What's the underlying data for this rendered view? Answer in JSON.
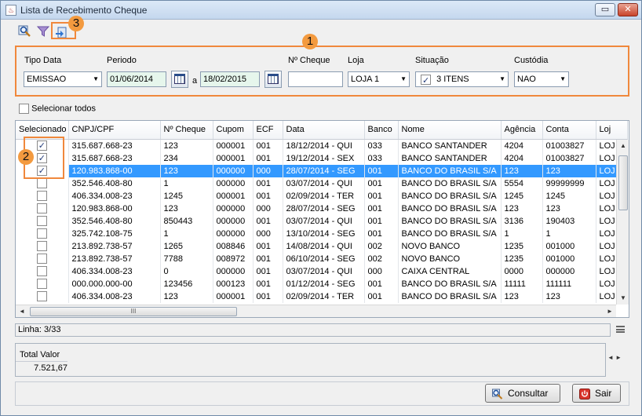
{
  "window": {
    "title": "Lista de Recebimento Cheque",
    "restore_glyph": "▭",
    "close_glyph": "✕"
  },
  "toolbar": {
    "icons": [
      "search-icon",
      "filter-icon",
      "export-icon"
    ]
  },
  "badges": [
    "1",
    "2",
    "3"
  ],
  "filters": {
    "tipo_data": {
      "label": "Tipo Data",
      "value": "EMISSAO"
    },
    "periodo": {
      "label": "Periodo",
      "from": "01/06/2014",
      "sep": "a",
      "to": "18/02/2015"
    },
    "cheque": {
      "label": "Nº Cheque",
      "value": ""
    },
    "loja": {
      "label": "Loja",
      "value": "LOJA 1"
    },
    "situacao": {
      "label": "Situação",
      "value": "3 ITENS"
    },
    "custodia": {
      "label": "Custódia",
      "value": "NAO"
    }
  },
  "select_all": {
    "label": "Selecionar todos"
  },
  "table": {
    "columns": [
      "Selecionado",
      "CNPJ/CPF",
      "Nº Cheque",
      "Cupom",
      "ECF",
      "Data",
      "Banco",
      "Nome",
      "Agência",
      "Conta",
      "Loj"
    ],
    "rows": [
      {
        "checked": true,
        "selected": false,
        "cells": [
          "315.687.668-23",
          "123",
          "000001",
          "001",
          "18/12/2014 - QUI",
          "033",
          "BANCO SANTANDER",
          "4204",
          "01003827",
          "LOJ"
        ]
      },
      {
        "checked": true,
        "selected": false,
        "cells": [
          "315.687.668-23",
          "234",
          "000001",
          "001",
          "19/12/2014 - SEX",
          "033",
          "BANCO SANTANDER",
          "4204",
          "01003827",
          "LOJ"
        ]
      },
      {
        "checked": true,
        "selected": true,
        "cells": [
          "120.983.868-00",
          "123",
          "000000",
          "000",
          "28/07/2014 - SEG",
          "001",
          "BANCO DO BRASIL S/A",
          "123",
          "123",
          "LOJ"
        ]
      },
      {
        "checked": false,
        "selected": false,
        "cells": [
          "352.546.408-80",
          "1",
          "000000",
          "001",
          "03/07/2014 - QUI",
          "001",
          "BANCO DO BRASIL S/A",
          "5554",
          "99999999",
          "LOJ"
        ]
      },
      {
        "checked": false,
        "selected": false,
        "cells": [
          "406.334.008-23",
          "1245",
          "000001",
          "001",
          "02/09/2014 - TER",
          "001",
          "BANCO DO BRASIL S/A",
          "1245",
          "1245",
          "LOJ"
        ]
      },
      {
        "checked": false,
        "selected": false,
        "cells": [
          "120.983.868-00",
          "123",
          "000000",
          "000",
          "28/07/2014 - SEG",
          "001",
          "BANCO DO BRASIL S/A",
          "123",
          "123",
          "LOJ"
        ]
      },
      {
        "checked": false,
        "selected": false,
        "cells": [
          "352.546.408-80",
          "850443",
          "000000",
          "001",
          "03/07/2014 - QUI",
          "001",
          "BANCO DO BRASIL S/A",
          "3136",
          "190403",
          "LOJ"
        ]
      },
      {
        "checked": false,
        "selected": false,
        "cells": [
          "325.742.108-75",
          "1",
          "000000",
          "000",
          "13/10/2014 - SEG",
          "001",
          "BANCO DO BRASIL S/A",
          "1",
          "1",
          "LOJ"
        ]
      },
      {
        "checked": false,
        "selected": false,
        "cells": [
          "213.892.738-57",
          "1265",
          "008846",
          "001",
          "14/08/2014 - QUI",
          "002",
          "NOVO BANCO",
          "1235",
          "001000",
          "LOJ"
        ]
      },
      {
        "checked": false,
        "selected": false,
        "cells": [
          "213.892.738-57",
          "7788",
          "008972",
          "001",
          "06/10/2014 - SEG",
          "002",
          "NOVO BANCO",
          "1235",
          "001000",
          "LOJ"
        ]
      },
      {
        "checked": false,
        "selected": false,
        "cells": [
          "406.334.008-23",
          "0",
          "000000",
          "001",
          "03/07/2014 - QUI",
          "000",
          "CAIXA CENTRAL",
          "0000",
          "000000",
          "LOJ"
        ]
      },
      {
        "checked": false,
        "selected": false,
        "cells": [
          "000.000.000-00",
          "123456",
          "000123",
          "001",
          "01/12/2014 - SEG",
          "001",
          "BANCO DO BRASIL S/A",
          "11111",
          "111111",
          "LOJ"
        ]
      },
      {
        "checked": false,
        "selected": false,
        "cells": [
          "406.334.008-23",
          "123",
          "000001",
          "001",
          "02/09/2014 - TER",
          "001",
          "BANCO DO BRASIL S/A",
          "123",
          "123",
          "LOJ"
        ]
      }
    ]
  },
  "scroll": {
    "up": "▲",
    "down": "▼",
    "left": "◄",
    "right": "►",
    "grip": "III"
  },
  "status": {
    "linha": "Linha: 3/33"
  },
  "totals": {
    "label": "Total Valor",
    "value": "7.521,67",
    "arrows": "◄ ►"
  },
  "buttons": {
    "consultar": "Consultar",
    "sair": "Sair"
  },
  "colors": {
    "accent": "#f0883c",
    "selection": "#3399ff"
  }
}
